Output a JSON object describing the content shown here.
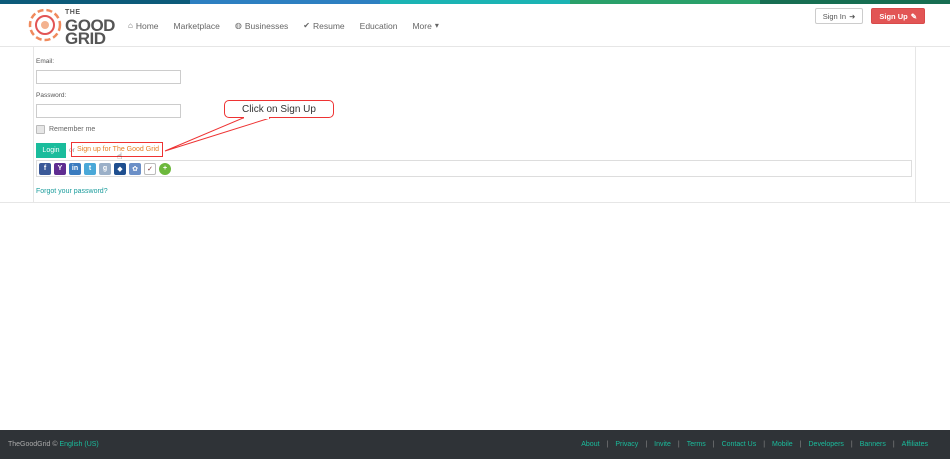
{
  "colors": {
    "stripe": [
      "#0d5b7a",
      "#2d7fc1",
      "#1bb3b3",
      "#2aa06a",
      "#176e52"
    ],
    "accent": "#1abc9c",
    "signup": "#e25555",
    "highlight": "#ee3333"
  },
  "logo": {
    "small": "THE",
    "big": "GOOD",
    "big2": "GRID"
  },
  "nav": {
    "home": "Home",
    "marketplace": "Marketplace",
    "businesses": "Businesses",
    "resume": "Resume",
    "education": "Education",
    "more": "More"
  },
  "auth": {
    "signin": "Sign In",
    "signup": "Sign Up"
  },
  "form": {
    "email_label": "Email:",
    "email_value": "",
    "password_label": "Password:",
    "password_value": "",
    "remember": "Remember me",
    "login": "Login",
    "or": "or",
    "signup_link": "Sign up for The Good Grid",
    "forgot": "Forgot your password?"
  },
  "social": [
    {
      "name": "facebook-icon",
      "glyph": "f",
      "color": "#3b5998"
    },
    {
      "name": "yahoo-icon",
      "glyph": "Y!",
      "color": "#5f2d91"
    },
    {
      "name": "linkedin-icon",
      "glyph": "in",
      "color": "#3a7bbf"
    },
    {
      "name": "twitter-icon",
      "glyph": "t",
      "color": "#4aa8d8"
    },
    {
      "name": "google-icon",
      "glyph": "g",
      "color": "#9bb0c8"
    },
    {
      "name": "windows-live-icon",
      "glyph": "◆",
      "color": "#1f4f8f"
    },
    {
      "name": "myspace-icon",
      "glyph": "✿",
      "color": "#6b8fc7"
    },
    {
      "name": "check-icon",
      "glyph": "✓",
      "color": "#ffffff"
    },
    {
      "name": "add-more-icon",
      "glyph": "+",
      "color": "#6cb83c"
    }
  ],
  "callout": "Click on Sign Up",
  "footer": {
    "copyright": "TheGoodGrid ©",
    "language": "English (US)",
    "links": [
      "About",
      "Privacy",
      "Invite",
      "Terms",
      "Contact Us",
      "Mobile",
      "Developers",
      "Banners",
      "Affiliates"
    ]
  }
}
